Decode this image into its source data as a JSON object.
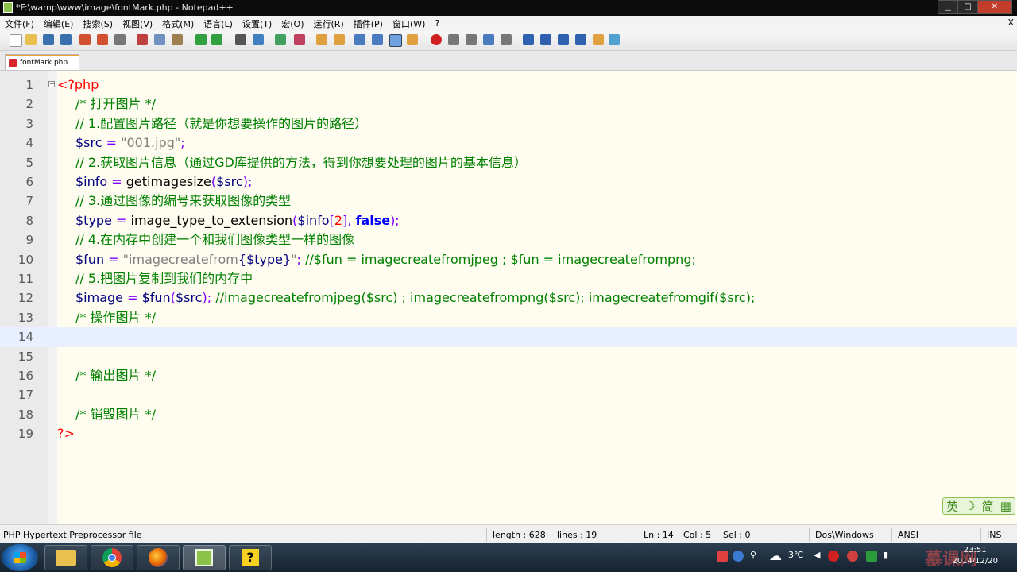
{
  "window": {
    "title": "*F:\\wamp\\www\\image\\fontMark.php - Notepad++",
    "min": "▁",
    "max": "□",
    "close": "✕"
  },
  "menu": [
    "文件(F)",
    "编辑(E)",
    "搜索(S)",
    "视图(V)",
    "格式(M)",
    "语言(L)",
    "设置(T)",
    "宏(O)",
    "运行(R)",
    "插件(P)",
    "窗口(W)",
    "?"
  ],
  "menu_close": "X",
  "tab": {
    "label": "fontMark.php"
  },
  "lines": [
    {
      "n": "1",
      "fold": "−",
      "indent": false,
      "tokens": [
        [
          "tag",
          "<?php"
        ]
      ]
    },
    {
      "n": "2",
      "indent": true,
      "tokens": [
        [
          "cmt",
          "/* 打开图片 */"
        ]
      ]
    },
    {
      "n": "3",
      "indent": true,
      "tokens": [
        [
          "cmt",
          "// 1.配置图片路径（就是你想要操作的图片的路径）"
        ]
      ]
    },
    {
      "n": "4",
      "indent": true,
      "tokens": [
        [
          "var",
          "$src"
        ],
        [
          "op",
          " = "
        ],
        [
          "str",
          "\"001.jpg\""
        ],
        [
          "op",
          ";"
        ]
      ]
    },
    {
      "n": "5",
      "indent": true,
      "tokens": [
        [
          "cmt",
          "// 2.获取图片信息（通过GD库提供的方法，得到你想要处理的图片的基本信息）"
        ]
      ]
    },
    {
      "n": "6",
      "indent": true,
      "tokens": [
        [
          "var",
          "$info"
        ],
        [
          "op",
          " = "
        ],
        [
          "fn",
          "getimagesize"
        ],
        [
          "op",
          "("
        ],
        [
          "var",
          "$src"
        ],
        [
          "op",
          ");"
        ]
      ]
    },
    {
      "n": "7",
      "indent": true,
      "tokens": [
        [
          "cmt",
          "// 3.通过图像的编号来获取图像的类型"
        ]
      ]
    },
    {
      "n": "8",
      "indent": true,
      "tokens": [
        [
          "var",
          "$type"
        ],
        [
          "op",
          " = "
        ],
        [
          "fn",
          "image_type_to_extension"
        ],
        [
          "op",
          "("
        ],
        [
          "var",
          "$info"
        ],
        [
          "op",
          "["
        ],
        [
          "num",
          "2"
        ],
        [
          "op",
          "], "
        ],
        [
          "kw",
          "false"
        ],
        [
          "op",
          ");"
        ]
      ]
    },
    {
      "n": "9",
      "indent": true,
      "tokens": [
        [
          "cmt",
          "// 4.在内存中创建一个和我们图像类型一样的图像"
        ]
      ]
    },
    {
      "n": "10",
      "indent": true,
      "tokens": [
        [
          "var",
          "$fun"
        ],
        [
          "op",
          " = "
        ],
        [
          "str",
          "\"imagecreatefrom"
        ],
        [
          "var",
          "{$type}"
        ],
        [
          "str",
          "\""
        ],
        [
          "op",
          "; "
        ],
        [
          "cmt",
          "//$fun = imagecreatefromjpeg ; $fun = imagecreatefrompng;"
        ]
      ]
    },
    {
      "n": "11",
      "indent": true,
      "tokens": [
        [
          "cmt",
          "// 5.把图片复制到我们的内存中"
        ]
      ]
    },
    {
      "n": "12",
      "indent": true,
      "tokens": [
        [
          "var",
          "$image"
        ],
        [
          "op",
          " = "
        ],
        [
          "var",
          "$fun"
        ],
        [
          "op",
          "("
        ],
        [
          "var",
          "$src"
        ],
        [
          "op",
          "); "
        ],
        [
          "cmt",
          "//imagecreatefromjpeg($src) ; imagecreatefrompng($src); imagecreatefromgif($src);"
        ]
      ]
    },
    {
      "n": "13",
      "indent": true,
      "tokens": [
        [
          "cmt",
          "/* 操作图片 */"
        ]
      ]
    },
    {
      "n": "14",
      "indent": true,
      "current": true,
      "tokens": []
    },
    {
      "n": "15",
      "indent": true,
      "tokens": []
    },
    {
      "n": "16",
      "indent": true,
      "tokens": [
        [
          "cmt",
          "/* 输出图片 */"
        ]
      ]
    },
    {
      "n": "17",
      "indent": true,
      "tokens": []
    },
    {
      "n": "18",
      "indent": true,
      "tokens": [
        [
          "cmt",
          "/* 销毁图片 */"
        ]
      ]
    },
    {
      "n": "19",
      "indent": false,
      "tokens": [
        [
          "tag",
          "?>"
        ]
      ]
    }
  ],
  "ime": {
    "lang": "英",
    "moon": "☽",
    "mode": "简",
    "kbd": "▦"
  },
  "status": {
    "filetype": "PHP Hypertext Preprocessor file",
    "length": "length : 628",
    "lines": "lines : 19",
    "ln": "Ln : 14",
    "col": "Col : 5",
    "sel": "Sel : 0",
    "eol": "Dos\\Windows",
    "enc": "ANSI",
    "mode": "INS"
  },
  "taskbar": {
    "temp": "3℃",
    "time": "23:51",
    "date": "2014/12/20",
    "watermark": "慕课网"
  },
  "colors": {
    "tag": "#ff0000",
    "comment": "#008000",
    "variable": "#000080",
    "operator": "#8000ff",
    "string": "#808080",
    "keyword": "#0000ff",
    "number": "#ff0000",
    "current_line": "#e8f0ff"
  }
}
